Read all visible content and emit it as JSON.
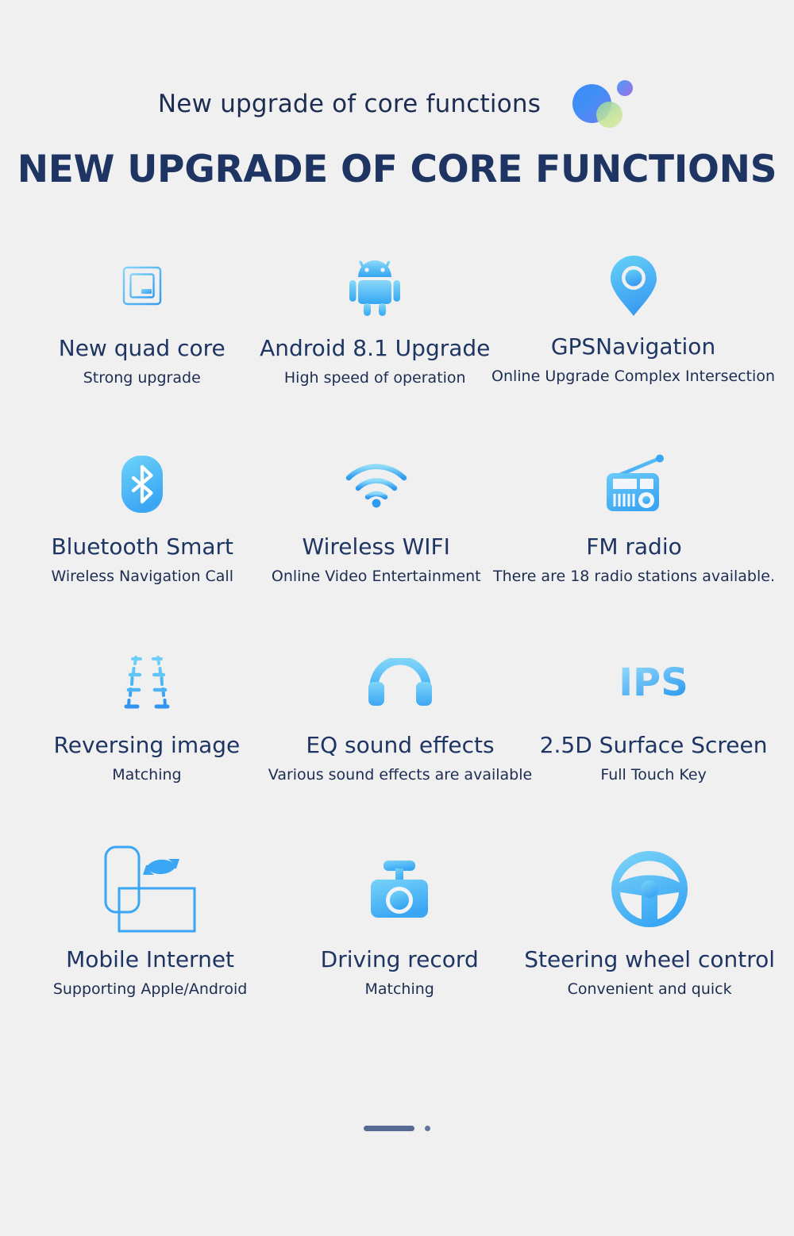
{
  "header": {
    "subtitle": "New upgrade of core functions",
    "title": "NEW UPGRADE OF CORE FUNCTIONS",
    "logo_icon": "overlapping-circles-logo",
    "colors": {
      "background": "#f0f0f0",
      "title_navy": "#1e3563",
      "text_navy": "#1d2d52",
      "icon_blue_light": "#7fd2f7",
      "icon_blue": "#3aa9f5",
      "icon_blue_deep": "#2f9bf0",
      "pager_slate": "#566a94",
      "logo_blue": "#3d8bf7",
      "logo_green": "#c8e59a",
      "logo_purple": "#9b6ee8"
    }
  },
  "features": [
    [
      {
        "icon": "cpu-chip-icon",
        "title": "New quad core",
        "subtitle": "Strong upgrade"
      },
      {
        "icon": "android-robot-icon",
        "title": "Android 8.1 Upgrade",
        "subtitle": "High speed of operation"
      },
      {
        "icon": "map-pin-icon",
        "title": "GPSNavigation",
        "subtitle": "Online Upgrade Complex Intersection"
      }
    ],
    [
      {
        "icon": "bluetooth-icon",
        "title": "Bluetooth Smart",
        "subtitle": "Wireless Navigation Call"
      },
      {
        "icon": "wifi-icon",
        "title": "Wireless WIFI",
        "subtitle": "Online Video Entertainment"
      },
      {
        "icon": "radio-icon",
        "title": "FM radio",
        "subtitle": "There are 18 radio stations available."
      }
    ],
    [
      {
        "icon": "parking-guide-lines-icon",
        "title": "Reversing image",
        "subtitle": "Matching"
      },
      {
        "icon": "headphones-icon",
        "title": "EQ sound effects",
        "subtitle": "Various sound effects are available"
      },
      {
        "icon": "ips-text-icon",
        "title": "2.5D Surface Screen",
        "subtitle": "Full Touch Key",
        "icon_label": "IPS"
      }
    ],
    [
      {
        "icon": "phone-screen-sync-icon",
        "title": "Mobile Internet",
        "subtitle": "Supporting Apple/Android"
      },
      {
        "icon": "dash-cam-icon",
        "title": "Driving record",
        "subtitle": "Matching"
      },
      {
        "icon": "steering-wheel-icon",
        "title": "Steering wheel control",
        "subtitle": "Convenient and quick"
      }
    ]
  ],
  "pager": {
    "active_index": 0,
    "total": 2
  }
}
